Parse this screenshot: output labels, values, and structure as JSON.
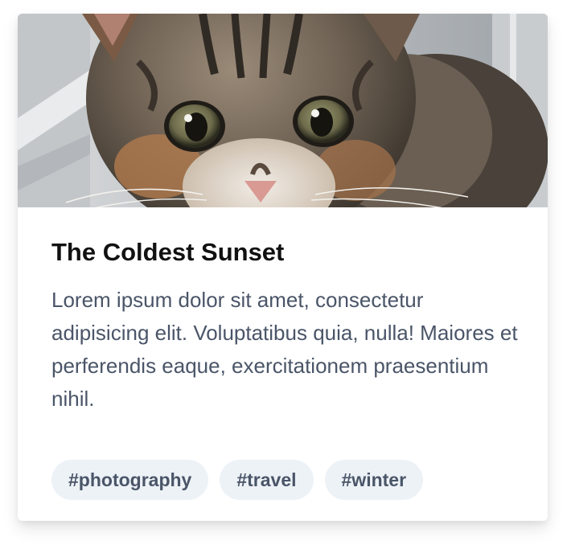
{
  "card": {
    "image_subject": "tabby kitten photo",
    "title": "The Coldest Sunset",
    "description": "Lorem ipsum dolor sit amet, consectetur adipisicing elit. Voluptatibus quia, nulla! Maiores et perferendis eaque, exercitationem praesentium nihil.",
    "tags": [
      {
        "label": "#photography"
      },
      {
        "label": "#travel"
      },
      {
        "label": "#winter"
      }
    ]
  },
  "colors": {
    "title": "#111111",
    "text": "#4a5568",
    "tag_background": "#edf2f7",
    "card_background": "#ffffff"
  }
}
